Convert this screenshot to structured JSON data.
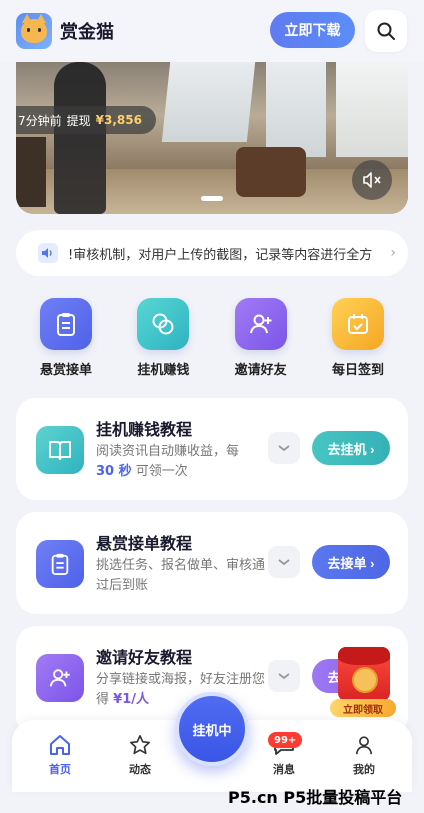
{
  "header": {
    "app_name": "赏金猫",
    "download_label": "立即下载"
  },
  "banner": {
    "withdraw_prefix": "7分钟前",
    "withdraw_label": "提现",
    "withdraw_amount": "¥3,856"
  },
  "notice": {
    "text": "!审核机制，对用户上传的截图，记录等内容进行全方"
  },
  "quick_actions": [
    {
      "label": "悬赏接单",
      "icon": "clipboard-icon",
      "color": "#5e6ff0"
    },
    {
      "label": "挂机赚钱",
      "icon": "coins-icon",
      "color": "#3ec3c9"
    },
    {
      "label": "邀请好友",
      "icon": "add-user-icon",
      "color": "#8a62ee"
    },
    {
      "label": "每日签到",
      "icon": "calendar-check-icon",
      "color": "#f6b632"
    }
  ],
  "tutorials": [
    {
      "title": "挂机赚钱教程",
      "desc_a": "阅读资讯自动赚收益，每",
      "desc_highlight": "30 秒",
      "desc_b": "可领一次",
      "button": "去挂机 ›",
      "color": "#3ec3c0"
    },
    {
      "title": "悬赏接单教程",
      "desc_a": "挑选任务、报名做单、审核通过后到账",
      "button": "去接单 ›",
      "color": "#5673ec"
    },
    {
      "title": "邀请好友教程",
      "desc_a": "分享链接或海报，好友注册您得",
      "desc_highlight": "¥1/人",
      "button": "去邀请 ›",
      "color": "#8a62ee"
    }
  ],
  "red_packet": {
    "label": "立即领取"
  },
  "bottom_nav": {
    "home": "首页",
    "feed": "动态",
    "center": "挂机中",
    "messages": "消息",
    "messages_badge": "99+",
    "mine": "我的"
  },
  "watermark": "P5.cn P5批量投稿平台"
}
